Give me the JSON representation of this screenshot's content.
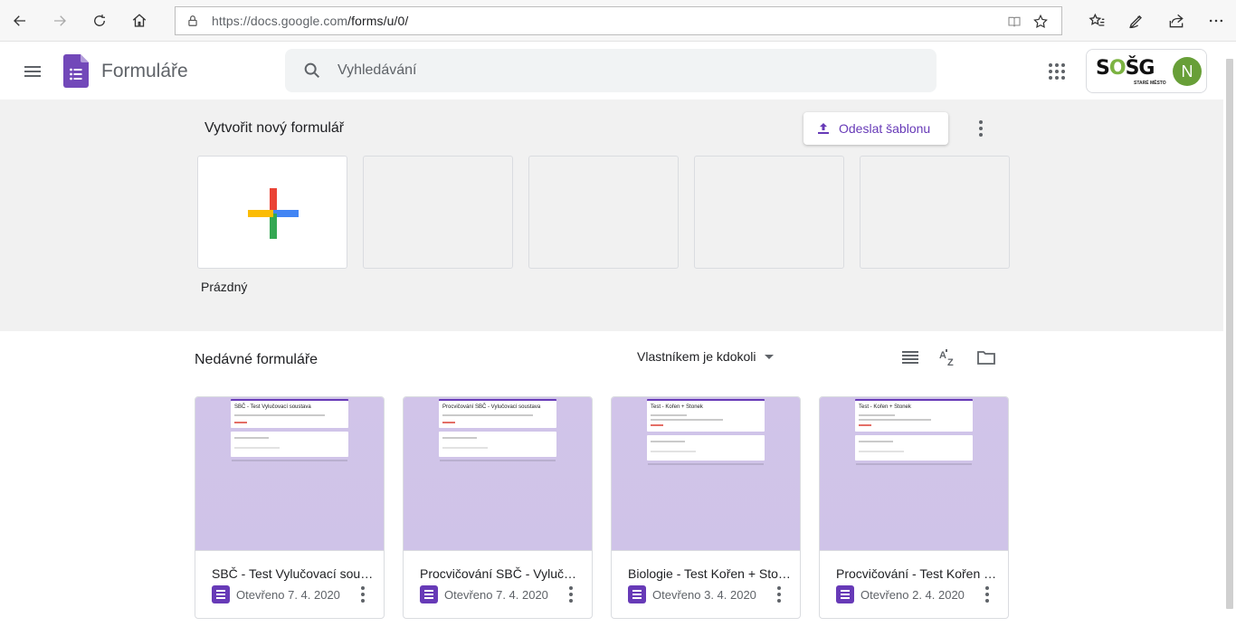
{
  "browser": {
    "url_host": "https://docs.google.com",
    "url_path": "/forms/u/0/",
    "icons": [
      "back-icon",
      "forward-icon",
      "refresh-icon",
      "home-icon",
      "lock-icon",
      "reading-view-icon",
      "star-icon",
      "favorites-icon",
      "pen-icon",
      "share-icon",
      "more-icon"
    ]
  },
  "header": {
    "title": "Formuláře",
    "search_placeholder": "Vyhledávání",
    "org_logo_text": "SOŠG",
    "org_logo_sub": "STARÉ MĚSTO",
    "avatar_initial": "N"
  },
  "templates": {
    "title": "Vytvořit nový formulář",
    "submit_label": "Odeslat šablonu",
    "blank_label": "Prázdný"
  },
  "recent": {
    "title": "Nedávné formuláře",
    "owner_filter": "Vlastníkem je kdokoli",
    "files": [
      {
        "name": "SBČ - Test Vylučovací soustava",
        "date": "Otevřeno 7. 4. 2020",
        "thumb_title": "SBČ - Test Vylučovací soustava"
      },
      {
        "name": "Procvičování SBČ - Vylučovací soustava",
        "date": "Otevřeno 7. 4. 2020",
        "thumb_title": "Procvičování SBČ - Vylučovací soustava"
      },
      {
        "name": "Biologie - Test Kořen + Stonek",
        "date": "Otevřeno 3. 4. 2020",
        "thumb_title": "Test - Kořen + Stonek"
      },
      {
        "name": "Procvičování - Test Kořen + Stonek",
        "date": "Otevřeno 2. 4. 2020",
        "thumb_title": "Test - Kořen + Stonek"
      }
    ]
  },
  "colors": {
    "forms_purple": "#673ab7",
    "thumb_bg": "#d1c4e9",
    "avatar_green": "#689f38"
  }
}
